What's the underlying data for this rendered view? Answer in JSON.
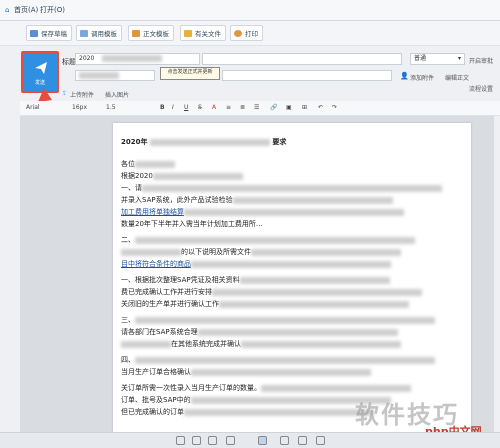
{
  "menubar": {
    "items": [
      "首页(A)",
      "打开(O)"
    ]
  },
  "toolbar": {
    "buttons": [
      "保存草稿",
      "调用模板",
      "正文模板",
      "有关文件",
      "打印"
    ]
  },
  "compose": {
    "send_label": "发送",
    "title_label": "标题",
    "title_value": "2020",
    "priority_value": "普通",
    "tooltip": "点击发送正式并更新",
    "right_links": [
      "开启审批",
      "添加附件",
      "编辑正文",
      "流程设置"
    ],
    "attach_label": "上传附件",
    "insert_label": "插入图片"
  },
  "format": {
    "font": "Arial",
    "size": "16px",
    "line_height": "1.5"
  },
  "document": {
    "heading": "2020年",
    "heading_tail": "要求",
    "lines": [
      "各位",
      "根据2020",
      "一、请",
      "并录入SAP系统，此外产品试验检验",
      "加工费用将单独结算",
      "数量20年下半年并入需当年计划加工费用所…",
      "二、",
      "的以下说明及所需文件",
      "目中将符合条件的商品",
      "一、根据批次整理SAP凭证及相关资料",
      "费已完成确认工作并进行安排",
      "关闭旧的生产单并进行确认工作",
      "三、",
      "请各部门在SAP系统合理",
      "在其他系统完成并确认",
      "当月生产订单合格确认",
      "四、",
      "关订单所需一次性录入当月生产订单的数量。",
      "订单、批号及SAP中的",
      "但已完成确认的订单"
    ]
  },
  "watermark": {
    "text": "软件技巧",
    "sub": "php中文网"
  },
  "colors": {
    "accent": "#2f8fe0",
    "highlight": "#e74c3c"
  }
}
